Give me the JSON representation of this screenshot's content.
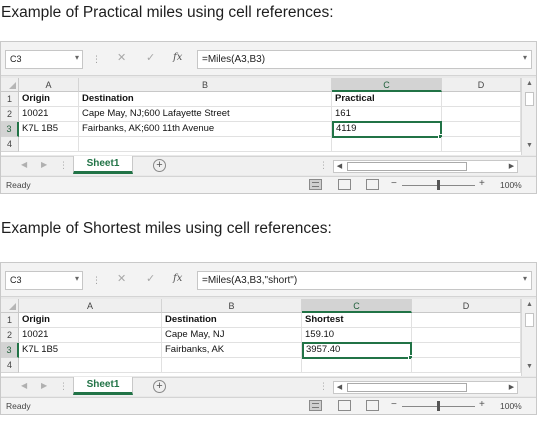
{
  "section1": {
    "heading": "Example of Practical miles using cell references:",
    "name_box": "C3",
    "formula": "=Miles(A3,B3)",
    "column_headers": [
      "A",
      "B",
      "C",
      "D"
    ],
    "row_headers": [
      "1",
      "2",
      "3",
      "4"
    ],
    "rows": [
      [
        "Origin",
        "Destination",
        "Practical"
      ],
      [
        "10021",
        "Cape May, NJ;600 Lafayette Street",
        "161"
      ],
      [
        "K7L 1B5",
        "Fairbanks, AK;600 11th Avenue",
        "4119"
      ]
    ],
    "sheet_tab": "Sheet1",
    "status": "Ready",
    "zoom": "100%"
  },
  "section2": {
    "heading": "Example of Shortest miles using cell references:",
    "name_box": "C3",
    "formula": "=Miles(A3,B3,\"short\")",
    "column_headers": [
      "A",
      "B",
      "C",
      "D"
    ],
    "row_headers": [
      "1",
      "2",
      "3",
      "4"
    ],
    "rows": [
      [
        "Origin",
        "Destination",
        "Shortest"
      ],
      [
        "10021",
        "Cape May, NJ",
        "159.10"
      ],
      [
        "K7L 1B5",
        "Fairbanks, AK",
        "3957.40"
      ]
    ],
    "sheet_tab": "Sheet1",
    "status": "Ready",
    "zoom": "100%"
  },
  "icons": {
    "dropdown": "▾",
    "cancel": "✕",
    "enter": "✓",
    "fx": "fx",
    "separator": "⋮",
    "nav_prev": "◀",
    "nav_next": "▶",
    "add_sheet": "+",
    "scroll_up": "▲",
    "scroll_down": "▼",
    "scroll_left": "◀",
    "scroll_right": "▶",
    "zoom_minus": "−",
    "zoom_plus": "+"
  },
  "colors": {
    "accent": "#217346",
    "grid_bg": "#ffffff",
    "chrome_bg": "#f0f0f0"
  }
}
